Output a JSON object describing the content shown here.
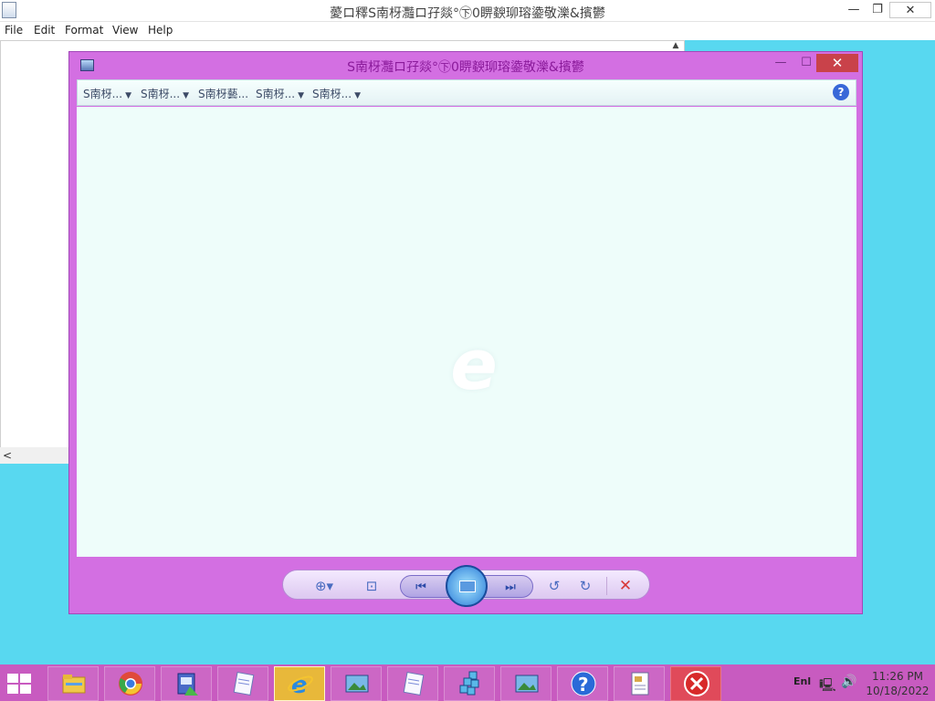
{
  "background_window": {
    "title": "薆ロ釋S南枒灩ロ孖燚°㊦0睤斔珋瑢鍌敬濼&擯鬱",
    "controls": {
      "minimize": "—",
      "maximize": "❐",
      "close": "✕"
    },
    "menu": [
      "File",
      "Edit",
      "Format",
      "View",
      "Help"
    ],
    "scroll_up": "▲",
    "scroll_left": "<"
  },
  "viewer": {
    "title": "S南枒灩ロ孖燚°㊦0睤斔珋瑢鍌敬濼&擯鬱",
    "controls": {
      "minimize": "—",
      "maximize": "☐",
      "close": "✕"
    },
    "toolbar": {
      "menus": [
        "S南枒...",
        "S南枒...",
        "S南枒藝...",
        "S南枒...",
        "S南枒..."
      ],
      "caret": "▼",
      "help": "?"
    },
    "watermark": "e",
    "controls_bar": {
      "zoom": "⊕▾",
      "fit": "⊡",
      "previous": "⏮",
      "next": "⏭",
      "rotate_left": "↺",
      "rotate_right": "↻",
      "delete": "✕"
    }
  },
  "taskbar": {
    "apps": [
      {
        "name": "file-explorer",
        "active": false
      },
      {
        "name": "chrome",
        "active": false
      },
      {
        "name": "install-package",
        "active": false
      },
      {
        "name": "notepad",
        "active": false
      },
      {
        "name": "internet-explorer",
        "active": true
      },
      {
        "name": "photo-viewer",
        "active": false
      },
      {
        "name": "notepad-2",
        "active": false
      },
      {
        "name": "app-grid",
        "active": false
      },
      {
        "name": "photo-viewer-2",
        "active": false
      },
      {
        "name": "help",
        "active": false
      },
      {
        "name": "document",
        "active": false
      },
      {
        "name": "error",
        "active": false
      }
    ],
    "tray": {
      "language": "Enl",
      "network": "🖳",
      "volume": "🔊",
      "time": "11:26 PM",
      "date": "10/18/2022"
    }
  }
}
